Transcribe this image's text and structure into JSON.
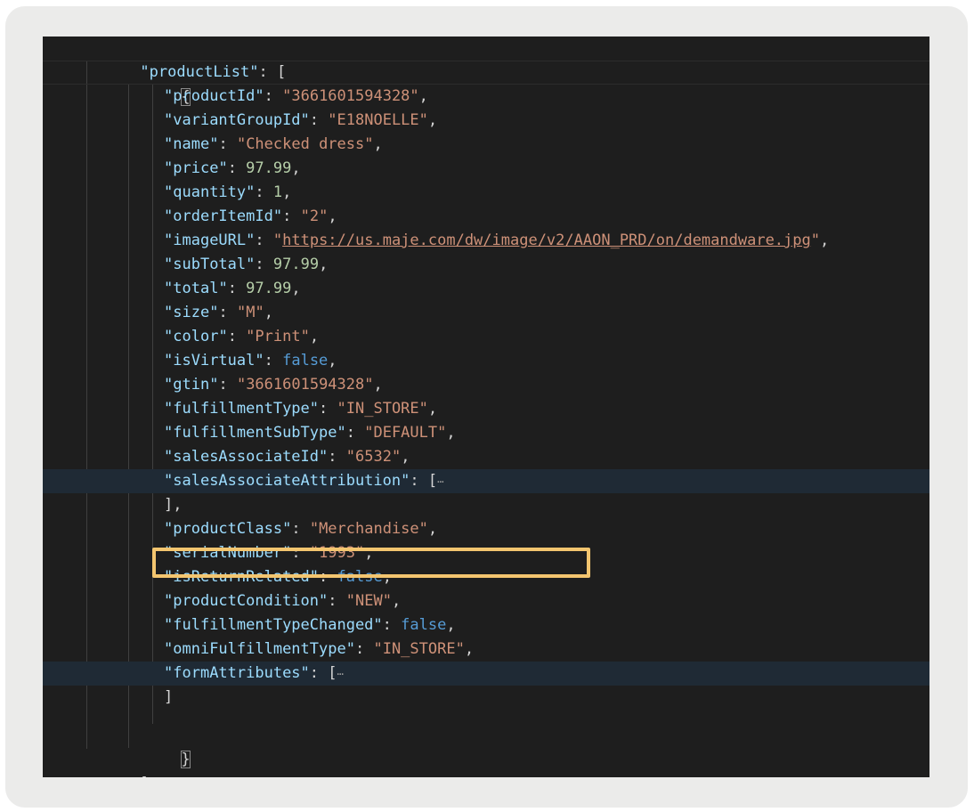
{
  "editor": {
    "opening": {
      "key": "productList",
      "bracket": "[",
      "brace": "{"
    },
    "closing": {
      "brace": "}",
      "bracket": "],"
    },
    "rows": [
      {
        "key": "productId",
        "value": "3661601594328",
        "type": "string"
      },
      {
        "key": "variantGroupId",
        "value": "E18NOELLE",
        "type": "string"
      },
      {
        "key": "name",
        "value": "Checked dress",
        "type": "string"
      },
      {
        "key": "price",
        "value": "97.99",
        "type": "number"
      },
      {
        "key": "quantity",
        "value": "1",
        "type": "number"
      },
      {
        "key": "orderItemId",
        "value": "2",
        "type": "string"
      },
      {
        "key": "imageURL",
        "value": "https://us.maje.com/dw/image/v2/AAON_PRD/on/demandware.jpg",
        "type": "url"
      },
      {
        "key": "subTotal",
        "value": "97.99",
        "type": "number"
      },
      {
        "key": "total",
        "value": "97.99",
        "type": "number"
      },
      {
        "key": "size",
        "value": "M",
        "type": "string"
      },
      {
        "key": "color",
        "value": "Print",
        "type": "string"
      },
      {
        "key": "isVirtual",
        "value": "false",
        "type": "boolean"
      },
      {
        "key": "gtin",
        "value": "3661601594328",
        "type": "string"
      },
      {
        "key": "fulfillmentType",
        "value": "IN_STORE",
        "type": "string"
      },
      {
        "key": "fulfillmentSubType",
        "value": "DEFAULT",
        "type": "string"
      },
      {
        "key": "salesAssociateId",
        "value": "6532",
        "type": "string"
      },
      {
        "key": "salesAssociateAttribution",
        "value": "[",
        "type": "folded",
        "close": "],"
      },
      {
        "key": "productClass",
        "value": "Merchandise",
        "type": "string"
      },
      {
        "key": "serialNumber",
        "value": "1993",
        "type": "string",
        "highlighted": true
      },
      {
        "key": "isReturnRelated",
        "value": "false",
        "type": "boolean"
      },
      {
        "key": "productCondition",
        "value": "NEW",
        "type": "string"
      },
      {
        "key": "fulfillmentTypeChanged",
        "value": "false",
        "type": "boolean"
      },
      {
        "key": "omniFulfillmentType",
        "value": "IN_STORE",
        "type": "string"
      },
      {
        "key": "formAttributes",
        "value": "[",
        "type": "folded",
        "close": "]"
      }
    ],
    "fold_glyph": "⋯",
    "highlight_color": "#f3c56f"
  }
}
